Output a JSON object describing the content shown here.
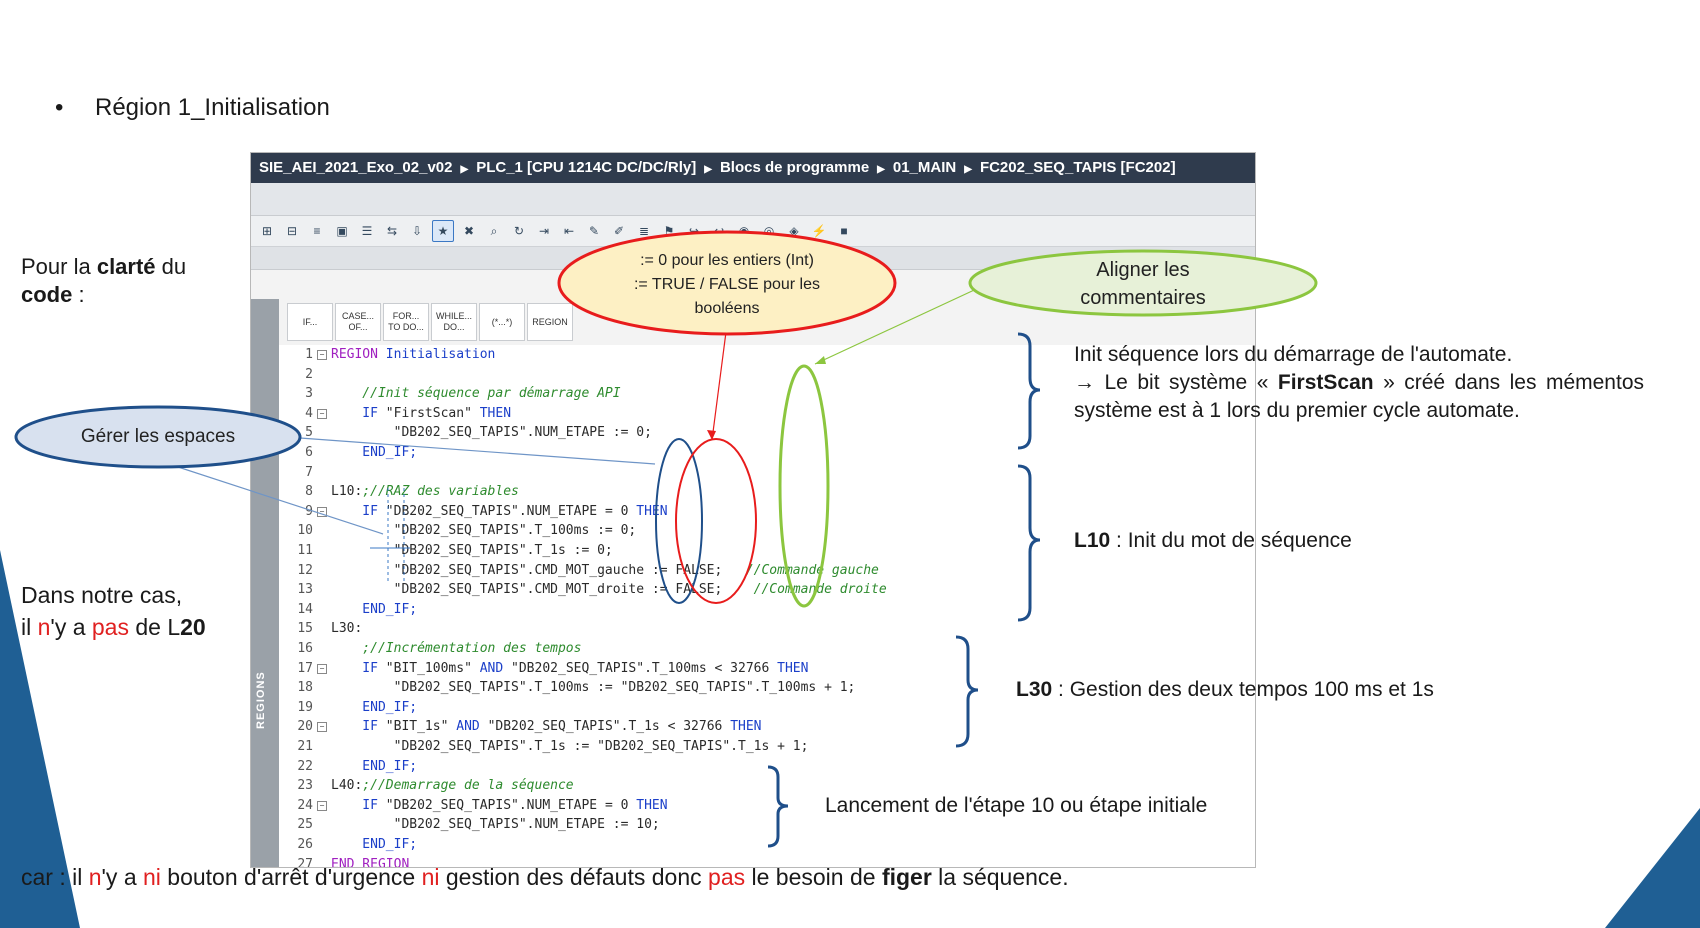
{
  "slide": {
    "bullet_title": "Région 1_Initialisation",
    "clarity_note": {
      "prefix": "Pour la ",
      "bold": "clarté",
      "suffix": " du",
      "line2_bold": "code",
      "line2_suffix": " :"
    },
    "case_note": {
      "line1": "Dans notre cas,",
      "line2": {
        "a": "il ",
        "b": "n",
        "c": "'y a ",
        "d": "pas",
        "e": " de L",
        "f": "20"
      }
    },
    "footer": {
      "p1": "car : il ",
      "p2": "n",
      "p3": "'y a ",
      "p4": "ni",
      "p5": " bouton d'arrêt d'urgence ",
      "p6": "ni",
      "p7": " gestion des défauts donc ",
      "p8": "pas",
      "p9": " le besoin de ",
      "p10": "figer",
      "p11": " la séquence."
    },
    "colors": {
      "accent_red": "#e02020",
      "deco_blue": "#1f5f94",
      "bubble_red_border": "#e81c1c",
      "bubble_green_border": "#8cc63f",
      "bubble_blue_border": "#1f4f8a"
    }
  },
  "tia": {
    "breadcrumb": [
      "SIE_AEI_2021_Exo_02_v02",
      "PLC_1 [CPU 1214C DC/DC/Rly]",
      "Blocs de programme",
      "01_MAIN",
      "FC202_SEQ_TAPIS [FC202]"
    ],
    "toolbar_icons": [
      "insert-network-icon",
      "delete-network-icon",
      "insert-row-icon",
      "monitor-icon",
      "list-icon",
      "compare-icon",
      "download-icon",
      "favorites-icon",
      "goto-error-icon",
      "search-icon",
      "refresh-icon",
      "indent-icon",
      "outdent-icon",
      "comment-icon",
      "uncomment-icon",
      "align-icon",
      "bookmark-icon",
      "next-bookmark-icon",
      "prev-bookmark-icon",
      "monitor-all-icon",
      "snapshot-icon",
      "watch-icon",
      "force-icon",
      "stop-icon"
    ],
    "snippets": [
      "IF...",
      "CASE...\nOF...",
      "FOR...\nTO DO...",
      "WHILE...\nDO...",
      "(*...*)",
      "REGION"
    ],
    "regions_label": "REGIONS",
    "code_lines": [
      {
        "n": "1",
        "fold": true,
        "parts": [
          {
            "t": "REGION",
            "c": "rg"
          },
          {
            "t": " Initialisation",
            "c": "kw"
          }
        ]
      },
      {
        "n": "2",
        "fold": false,
        "parts": []
      },
      {
        "n": "3",
        "fold": false,
        "parts": [
          {
            "t": "    //Init séquence par démarrage API",
            "c": "cm"
          }
        ]
      },
      {
        "n": "4",
        "fold": true,
        "parts": [
          {
            "t": "    IF ",
            "c": "kw"
          },
          {
            "t": "\"FirstScan\"",
            "c": "ob"
          },
          {
            "t": " THEN",
            "c": "kw"
          }
        ]
      },
      {
        "n": "5",
        "fold": false,
        "parts": [
          {
            "t": "        \"DB202_SEQ_TAPIS\".NUM_ETAPE := 0;",
            "c": "ob"
          }
        ]
      },
      {
        "n": "6",
        "fold": false,
        "parts": [
          {
            "t": "    END_IF;",
            "c": "kw"
          }
        ]
      },
      {
        "n": "7",
        "fold": false,
        "parts": []
      },
      {
        "n": "8",
        "fold": false,
        "parts": [
          {
            "t": "L10:",
            "c": "ob"
          },
          {
            "t": ";//RAZ des variables",
            "c": "cm"
          }
        ]
      },
      {
        "n": "9",
        "fold": true,
        "parts": [
          {
            "t": "    IF ",
            "c": "kw"
          },
          {
            "t": "\"DB202_SEQ_TAPIS\".NUM_ETAPE = 0 ",
            "c": "ob"
          },
          {
            "t": "THEN",
            "c": "kw"
          }
        ]
      },
      {
        "n": "10",
        "fold": false,
        "parts": [
          {
            "t": "        \"DB202_SEQ_TAPIS\".T_100ms := 0;",
            "c": "ob"
          }
        ]
      },
      {
        "n": "11",
        "fold": false,
        "parts": [
          {
            "t": "        \"DB202_SEQ_TAPIS\".T_1s := 0;",
            "c": "ob"
          }
        ]
      },
      {
        "n": "12",
        "fold": false,
        "parts": [
          {
            "t": "        \"DB202_SEQ_TAPIS\".CMD_MOT_gauche := FALSE;  ",
            "c": "ob"
          },
          {
            "t": " //Commande gauche",
            "c": "cm"
          }
        ]
      },
      {
        "n": "13",
        "fold": false,
        "parts": [
          {
            "t": "        \"DB202_SEQ_TAPIS\".CMD_MOT_droite := FALSE;  ",
            "c": "ob"
          },
          {
            "t": "  //Commande droite",
            "c": "cm"
          }
        ]
      },
      {
        "n": "14",
        "fold": false,
        "parts": [
          {
            "t": "    END_IF;",
            "c": "kw"
          }
        ]
      },
      {
        "n": "15",
        "fold": false,
        "parts": [
          {
            "t": "L30:",
            "c": "ob"
          }
        ]
      },
      {
        "n": "16",
        "fold": false,
        "parts": [
          {
            "t": "    ;//Incrémentation des tempos",
            "c": "cm"
          }
        ]
      },
      {
        "n": "17",
        "fold": true,
        "parts": [
          {
            "t": "    IF ",
            "c": "kw"
          },
          {
            "t": "\"BIT_100ms\" ",
            "c": "ob"
          },
          {
            "t": "AND ",
            "c": "kw"
          },
          {
            "t": "\"DB202_SEQ_TAPIS\".T_100ms < 32766 ",
            "c": "ob"
          },
          {
            "t": "THEN",
            "c": "kw"
          }
        ]
      },
      {
        "n": "18",
        "fold": false,
        "parts": [
          {
            "t": "        \"DB202_SEQ_TAPIS\".T_100ms := \"DB202_SEQ_TAPIS\".T_100ms + 1;",
            "c": "ob"
          }
        ]
      },
      {
        "n": "19",
        "fold": false,
        "parts": [
          {
            "t": "    END_IF;",
            "c": "kw"
          }
        ]
      },
      {
        "n": "20",
        "fold": true,
        "parts": [
          {
            "t": "    IF ",
            "c": "kw"
          },
          {
            "t": "\"BIT_1s\" ",
            "c": "ob"
          },
          {
            "t": "AND ",
            "c": "kw"
          },
          {
            "t": "\"DB202_SEQ_TAPIS\".T_1s < 32766 ",
            "c": "ob"
          },
          {
            "t": "THEN",
            "c": "kw"
          }
        ]
      },
      {
        "n": "21",
        "fold": false,
        "parts": [
          {
            "t": "        \"DB202_SEQ_TAPIS\".T_1s := \"DB202_SEQ_TAPIS\".T_1s + 1;",
            "c": "ob"
          }
        ]
      },
      {
        "n": "22",
        "fold": false,
        "parts": [
          {
            "t": "    END_IF;",
            "c": "kw"
          }
        ]
      },
      {
        "n": "23",
        "fold": false,
        "parts": [
          {
            "t": "L40:",
            "c": "ob"
          },
          {
            "t": ";//Demarrage de la séquence",
            "c": "cm"
          }
        ]
      },
      {
        "n": "24",
        "fold": true,
        "parts": [
          {
            "t": "    IF ",
            "c": "kw"
          },
          {
            "t": "\"DB202_SEQ_TAPIS\".NUM_ETAPE = 0 ",
            "c": "ob"
          },
          {
            "t": "THEN",
            "c": "kw"
          }
        ]
      },
      {
        "n": "25",
        "fold": false,
        "parts": [
          {
            "t": "        \"DB202_SEQ_TAPIS\".NUM_ETAPE := 10;",
            "c": "ob"
          }
        ]
      },
      {
        "n": "26",
        "fold": false,
        "parts": [
          {
            "t": "    END_IF;",
            "c": "kw"
          }
        ]
      },
      {
        "n": "27",
        "fold": false,
        "parts": [
          {
            "t": "END_REGION",
            "c": "rg"
          }
        ]
      }
    ]
  },
  "callouts": {
    "red_bubble": {
      "l1": ":= 0 pour les entiers (Int)",
      "l2": ":= TRUE / FALSE pour les",
      "l3": "booléens"
    },
    "green_bubble": {
      "l1": "Aligner les",
      "l2": "commentaires"
    },
    "blue_bubble": {
      "text": "Gérer les espaces"
    }
  },
  "annotations": {
    "init_block": {
      "line1": "Init séquence lors du démarrage de l'automate.",
      "arrow": "→ Le bit système « ",
      "bold": "FirstScan",
      "rest": " » créé dans les mémentos système est à 1 lors du premier cycle automate."
    },
    "l10": {
      "bold": "L10",
      "text": " : Init du mot de séquence"
    },
    "l30": {
      "bold": "L30",
      "text": " : Gestion des deux tempos 100 ms et 1s"
    },
    "l40": {
      "text": "Lancement de l'étape 10 ou étape initiale"
    }
  }
}
